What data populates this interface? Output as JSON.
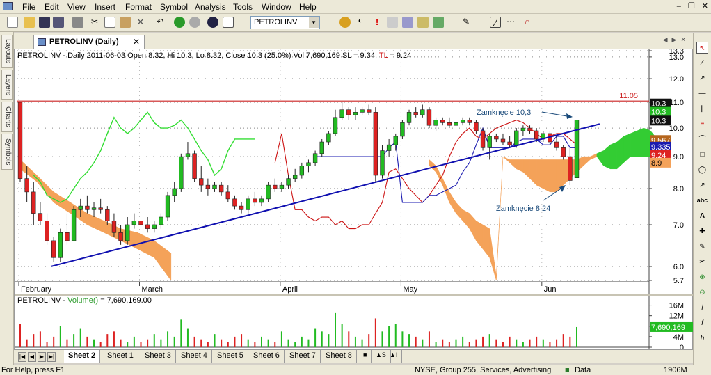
{
  "menu": [
    "File",
    "Edit",
    "View",
    "Insert",
    "Format",
    "Symbol",
    "Analysis",
    "Tools",
    "Window",
    "Help"
  ],
  "toolbar": {
    "symbol": "PETROLINV"
  },
  "left_tabs": [
    "Layouts",
    "Layers",
    "Charts",
    "Symbols"
  ],
  "chart_tab": {
    "title": "PETROLINV (Daily)"
  },
  "chart": {
    "title_prefix": "PETROLINV - Daily 2011-06-03 Open 8.32, Hi 10.3, Lo 8.32, Close 10.3 (25.0%) Vol 7,690,169 SL = 9.34, ",
    "tl_label": "TL",
    "tl_value": " = 9.24",
    "resistance_label": "11.05",
    "annotations": [
      "Zamknęcie 10,3",
      "Zamknęcie 8,24"
    ],
    "price_labels": [
      "10.3",
      "10.3",
      "10.3",
      "9.5675",
      "9.335",
      "9.24",
      "8.9"
    ],
    "volume_title_prefix": "PETROLINV - ",
    "volume_title_fn": "Volume()",
    "volume_title_value": " = 7,690,169.00",
    "volume_label": "7,690,169",
    "colors": {
      "up": "#22bb22",
      "down": "#dd2222",
      "trend": "#1010b0",
      "cloud_bull": "#33cc33",
      "cloud_bear": "#f4a259",
      "tenkan": "#cc1111",
      "kijun": "#1a1ab0",
      "chikou": "#33dd33",
      "resistance": "#cc2222"
    }
  },
  "chart_data": [
    {
      "type": "candlestick",
      "x_labels": [
        "February",
        "March",
        "April",
        "May",
        "Jun"
      ],
      "y_ticks": [
        "13.3",
        "13.0",
        "12.0",
        "11.0",
        "10.0",
        "9.0",
        "8.0",
        "7.0",
        "6.0",
        "5.7"
      ],
      "ylim": [
        5.7,
        13.3
      ],
      "y_scale": "log",
      "resistance": 11.05,
      "ohlc": [
        [
          11.0,
          11.0,
          8.2,
          8.3
        ],
        [
          8.3,
          8.7,
          7.6,
          7.9
        ],
        [
          7.9,
          8.2,
          7.0,
          7.3
        ],
        [
          7.3,
          7.6,
          7.0,
          7.1
        ],
        [
          7.1,
          7.3,
          6.5,
          6.6
        ],
        [
          6.6,
          6.7,
          6.1,
          6.2
        ],
        [
          6.2,
          6.9,
          6.1,
          6.8
        ],
        [
          6.8,
          7.3,
          6.5,
          6.6
        ],
        [
          6.6,
          7.5,
          6.6,
          7.4
        ],
        [
          7.4,
          7.7,
          7.2,
          7.5
        ],
        [
          7.5,
          7.8,
          7.3,
          7.4
        ],
        [
          7.4,
          7.6,
          7.2,
          7.45
        ],
        [
          7.45,
          7.7,
          7.3,
          7.4
        ],
        [
          7.4,
          7.5,
          7.0,
          7.1
        ],
        [
          7.1,
          7.3,
          6.7,
          6.8
        ],
        [
          6.8,
          7.0,
          6.5,
          6.6
        ],
        [
          6.6,
          7.2,
          6.5,
          7.0
        ],
        [
          7.0,
          7.3,
          6.9,
          7.1
        ],
        [
          7.1,
          7.3,
          6.9,
          7.0
        ],
        [
          7.0,
          7.2,
          6.8,
          6.9
        ],
        [
          6.9,
          7.1,
          6.8,
          7.0
        ],
        [
          7.0,
          7.3,
          6.9,
          7.2
        ],
        [
          7.2,
          7.9,
          7.1,
          7.8
        ],
        [
          7.8,
          8.2,
          7.6,
          8.0
        ],
        [
          8.0,
          9.1,
          7.9,
          9.0
        ],
        [
          9.0,
          9.5,
          8.9,
          9.1
        ],
        [
          9.1,
          9.2,
          8.2,
          8.3
        ],
        [
          8.3,
          8.7,
          7.9,
          8.1
        ],
        [
          8.1,
          8.3,
          7.8,
          8.0
        ],
        [
          8.0,
          8.2,
          7.9,
          8.1
        ],
        [
          8.1,
          8.2,
          7.8,
          7.9
        ],
        [
          7.9,
          8.1,
          7.6,
          7.7
        ],
        [
          7.7,
          7.8,
          7.4,
          7.5
        ],
        [
          7.5,
          7.6,
          7.3,
          7.4
        ],
        [
          7.4,
          7.8,
          7.3,
          7.7
        ],
        [
          7.7,
          7.9,
          7.5,
          7.6
        ],
        [
          7.6,
          7.8,
          7.5,
          7.7
        ],
        [
          7.7,
          8.2,
          7.6,
          8.1
        ],
        [
          8.1,
          8.3,
          7.9,
          8.0
        ],
        [
          8.0,
          8.2,
          7.9,
          8.1
        ],
        [
          8.1,
          8.4,
          8.0,
          8.3
        ],
        [
          8.3,
          8.6,
          8.2,
          8.4
        ],
        [
          8.4,
          8.8,
          8.3,
          8.7
        ],
        [
          8.7,
          8.9,
          8.5,
          8.8
        ],
        [
          8.8,
          9.2,
          8.7,
          9.1
        ],
        [
          9.1,
          9.6,
          9.0,
          9.5
        ],
        [
          9.5,
          9.9,
          9.4,
          9.8
        ],
        [
          9.8,
          10.7,
          9.7,
          10.4
        ],
        [
          10.4,
          11.0,
          10.3,
          10.7
        ],
        [
          10.7,
          10.8,
          10.3,
          10.5
        ],
        [
          10.5,
          10.8,
          10.3,
          10.6
        ],
        [
          10.6,
          10.8,
          10.5,
          10.7
        ],
        [
          10.7,
          10.9,
          10.5,
          10.6
        ],
        [
          10.6,
          10.8,
          8.2,
          8.4
        ],
        [
          8.4,
          9.4,
          8.3,
          9.2
        ],
        [
          9.2,
          9.6,
          9.0,
          9.4
        ],
        [
          9.4,
          9.8,
          9.2,
          9.7
        ],
        [
          9.7,
          10.3,
          9.6,
          10.2
        ],
        [
          10.2,
          10.7,
          10.1,
          10.6
        ],
        [
          10.6,
          10.8,
          10.4,
          10.5
        ],
        [
          10.5,
          10.9,
          10.4,
          10.7
        ],
        [
          10.7,
          10.8,
          10.0,
          10.1
        ],
        [
          10.1,
          10.4,
          9.9,
          10.3
        ],
        [
          10.3,
          10.4,
          10.1,
          10.2
        ],
        [
          10.2,
          10.4,
          10.0,
          10.1
        ],
        [
          10.1,
          10.3,
          10.0,
          10.2
        ],
        [
          10.2,
          10.4,
          10.1,
          10.3
        ],
        [
          10.3,
          10.4,
          10.1,
          10.2
        ],
        [
          10.2,
          10.3,
          9.8,
          9.9
        ],
        [
          9.9,
          10.0,
          9.2,
          9.3
        ],
        [
          9.3,
          9.8,
          8.9,
          9.7
        ],
        [
          9.7,
          9.8,
          9.5,
          9.6
        ],
        [
          9.6,
          9.8,
          9.4,
          9.5
        ],
        [
          9.5,
          9.7,
          9.3,
          9.4
        ],
        [
          9.4,
          10.0,
          9.3,
          9.9
        ],
        [
          9.9,
          10.1,
          9.7,
          10.0
        ],
        [
          10.0,
          10.1,
          9.8,
          9.9
        ],
        [
          9.9,
          10.0,
          9.5,
          9.6
        ],
        [
          9.6,
          9.9,
          9.5,
          9.8
        ],
        [
          9.8,
          9.9,
          9.4,
          9.5
        ],
        [
          9.5,
          9.7,
          9.2,
          9.3
        ],
        [
          9.3,
          9.4,
          8.9,
          9.0
        ],
        [
          9.0,
          9.3,
          8.1,
          8.24
        ],
        [
          8.32,
          10.3,
          8.32,
          10.3
        ]
      ],
      "trendline": [
        [
          6.0,
          0
        ],
        [
          10.15,
          86
        ]
      ],
      "tenkan": [
        8.8,
        9.8,
        8.4,
        7.4,
        7.4,
        7.2,
        7.1,
        7.2,
        7.2,
        7.0,
        7.1,
        6.9,
        6.9,
        7.0,
        7.0,
        7.3,
        7.6,
        8.5,
        8.6,
        8.3,
        8.0,
        7.8,
        7.6,
        7.8,
        8.1,
        8.4,
        9.0,
        9.5,
        9.8,
        10.0,
        9.7,
        9.6,
        9.8,
        10.0,
        10.1,
        10.2,
        10.3,
        10.2,
        10.0,
        9.8,
        9.6,
        9.7,
        9.8,
        9.8,
        9.6,
        9.4
      ],
      "kijun": [
        9.0,
        9.0,
        9.0,
        9.0,
        9.0,
        9.0,
        9.0,
        9.0,
        9.0,
        9.0,
        9.0,
        9.3,
        9.5,
        7.6,
        7.6,
        7.6,
        7.6,
        7.8,
        7.8,
        7.9,
        8.0,
        8.1,
        8.5,
        8.8,
        9.4,
        10.0,
        9.3,
        9.3,
        9.3,
        9.3,
        9.5,
        9.6,
        9.6,
        9.6,
        9.4,
        9.4,
        9.7,
        9.7,
        9.3,
        9.3
      ],
      "chikou": [
        8.4,
        8.2,
        7.8,
        7.7,
        7.6,
        7.7,
        8.0,
        8.3,
        8.5,
        8.8,
        9.2,
        9.8,
        10.4,
        10.0,
        9.8,
        10.0,
        10.3,
        10.6,
        10.2,
        10.0,
        10.0,
        10.1,
        10.3,
        10.0,
        9.6,
        9.2,
        8.9,
        8.4,
        8.6,
        9.2,
        9.6,
        9.6,
        9.6,
        9.6
      ],
      "cloud_a": [
        8.9,
        8.7,
        8.3,
        7.9,
        7.6,
        7.4,
        7.3,
        7.1,
        7.0,
        6.9,
        5.8,
        9.0,
        8.9,
        8.9,
        8.9,
        8.9,
        8.9,
        8.9,
        8.9,
        8.9,
        8.9,
        8.9,
        8.9,
        9.0,
        9.0,
        9.0,
        9.2,
        9.4,
        9.5,
        9.7,
        9.8,
        9.9,
        10.0,
        9.9,
        9.6
      ],
      "cloud_b": [
        8.7,
        8.5,
        8.1,
        7.6,
        7.3,
        7.1,
        6.9,
        6.6,
        6.4,
        6.2,
        5.7,
        9.0,
        8.8,
        8.6,
        8.5,
        8.3,
        8.1,
        8.0,
        7.9,
        7.9,
        8.1,
        8.3,
        8.5,
        8.7,
        8.9,
        9.1,
        8.7,
        8.6,
        8.6,
        8.8,
        9.0,
        9.0,
        9.0,
        9.0,
        9.0
      ],
      "volume": [
        9.0,
        3.0,
        5.0,
        6.0,
        2.0,
        4.0,
        8.0,
        3.0,
        5.0,
        7.0,
        4.0,
        3.0,
        2.0,
        5.0,
        6.0,
        3.0,
        2.0,
        4.0,
        2.0,
        3.0,
        5.0,
        3.0,
        6.0,
        4.0,
        10.5,
        7.0,
        4.0,
        3.0,
        2.0,
        5.0,
        3.0,
        2.0,
        4.0,
        5.0,
        3.0,
        2.0,
        4.0,
        3.0,
        2.0,
        6.0,
        3.0,
        2.0,
        4.0,
        3.0,
        7.0,
        6.0,
        5.0,
        13.0,
        9.0,
        6.0,
        4.0,
        3.0,
        5.0,
        11.0,
        6.0,
        8.0,
        9.0,
        6.0,
        5.0,
        4.0,
        3.0,
        6.0,
        2.0,
        3.0,
        2.0,
        3.0,
        4.0,
        2.0,
        3.0,
        4.0,
        5.0,
        3.0,
        2.0,
        4.0,
        3.0,
        2.0,
        3.0,
        4.0,
        3.0,
        2.0,
        3.0,
        5.0,
        4.0,
        7.69
      ],
      "volume_ticks": [
        "16M",
        "12M",
        "8M",
        "4M",
        "0"
      ]
    }
  ],
  "sheets": [
    "Sheet 2",
    "Sheet 1",
    "Sheet 3",
    "Sheet 4",
    "Sheet 5",
    "Sheet 6",
    "Sheet 7",
    "Sheet 8"
  ],
  "status": {
    "help": "For Help, press F1",
    "exchange": "NYSE, Group 255, Services, Advertising",
    "data": "Data",
    "mem": "1906M"
  }
}
